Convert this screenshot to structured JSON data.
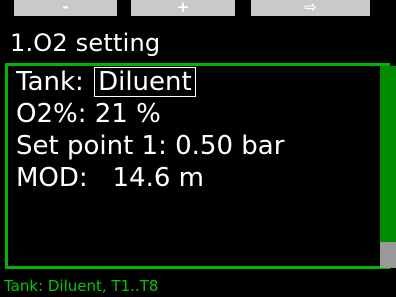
{
  "softkeys": {
    "left_label": "-",
    "center_label": "+",
    "right_label": "⇨"
  },
  "screen": {
    "title": "1.O2 setting"
  },
  "settings": {
    "tank_label": "Tank: ",
    "tank_value": "Diluent",
    "o2_label": "O2%: ",
    "o2_value": "21 %",
    "setpoint_label": "Set point 1: ",
    "setpoint_value": "0.50 bar",
    "mod_label": "MOD:   ",
    "mod_value": "14.6 m"
  },
  "footer": {
    "hint": "Tank: Diluent, T1..T8"
  },
  "colors": {
    "accent_green": "#00b400",
    "hint_green": "#00c800",
    "softkey_gray": "#c9c9c9"
  }
}
